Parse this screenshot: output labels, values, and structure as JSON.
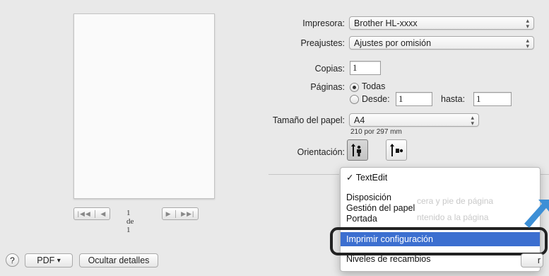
{
  "preview": {
    "pager_label": "1 de 1",
    "first_prev": "|◀◀ │ ◀",
    "next_last": "▶ │ ▶▶|"
  },
  "form": {
    "printer_label": "Impresora:",
    "printer_value": "Brother HL-xxxx",
    "presets_label": "Preajustes:",
    "presets_value": "Ajustes por omisión",
    "copies_label": "Copias:",
    "copies_value": "1",
    "pages_label": "Páginas:",
    "pages_all": "Todas",
    "pages_from": "Desde:",
    "from_value": "1",
    "pages_to": "hasta:",
    "to_value": "1",
    "paper_label": "Tamaño del papel:",
    "paper_value": "A4",
    "paper_dims": "210 por 297 mm",
    "orientation_label": "Orientación:"
  },
  "menu": {
    "check": "✓",
    "items": [
      "TextEdit",
      "Disposición",
      "Gestión del papel",
      "Portada",
      "Imprimir configuración",
      "Niveles de recambios"
    ],
    "highlighted": "Imprimir configuración"
  },
  "background_hints": [
    "cera y pie de página",
    "ntenido a la página"
  ],
  "bottom": {
    "help": "?",
    "pdf": "PDF",
    "pdf_arrow": "▾",
    "hide_details": "Ocultar detalles",
    "right_btn_tail": "r"
  },
  "colors": {
    "menu_highlight": "#3c6fd0",
    "callout_arrow": "#3d8fd6"
  },
  "icons": {
    "arrows": "updown-arrows-icon",
    "portrait": "portrait-orientation-icon",
    "landscape": "landscape-orientation-icon",
    "blue_arrow": "pointer-arrow-icon"
  }
}
